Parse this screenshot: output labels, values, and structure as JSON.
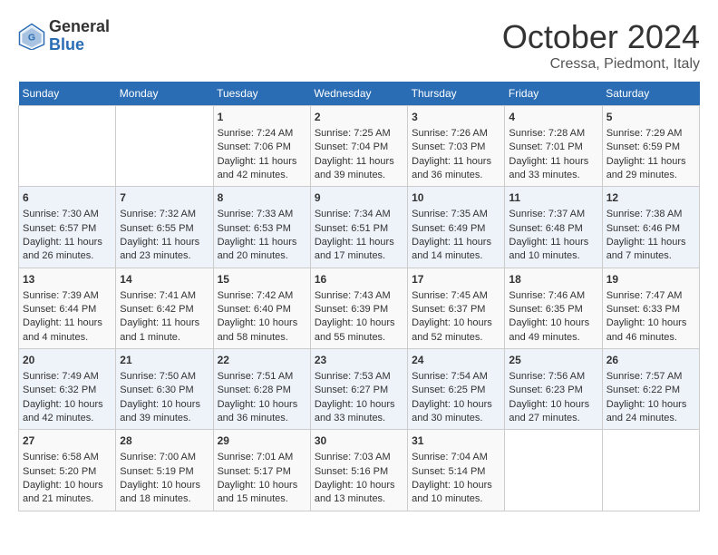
{
  "header": {
    "logo_general": "General",
    "logo_blue": "Blue",
    "title": "October 2024",
    "subtitle": "Cressa, Piedmont, Italy"
  },
  "days_of_week": [
    "Sunday",
    "Monday",
    "Tuesday",
    "Wednesday",
    "Thursday",
    "Friday",
    "Saturday"
  ],
  "weeks": [
    [
      {
        "day": "",
        "sunrise": "",
        "sunset": "",
        "daylight": ""
      },
      {
        "day": "",
        "sunrise": "",
        "sunset": "",
        "daylight": ""
      },
      {
        "day": "1",
        "sunrise": "Sunrise: 7:24 AM",
        "sunset": "Sunset: 7:06 PM",
        "daylight": "Daylight: 11 hours and 42 minutes."
      },
      {
        "day": "2",
        "sunrise": "Sunrise: 7:25 AM",
        "sunset": "Sunset: 7:04 PM",
        "daylight": "Daylight: 11 hours and 39 minutes."
      },
      {
        "day": "3",
        "sunrise": "Sunrise: 7:26 AM",
        "sunset": "Sunset: 7:03 PM",
        "daylight": "Daylight: 11 hours and 36 minutes."
      },
      {
        "day": "4",
        "sunrise": "Sunrise: 7:28 AM",
        "sunset": "Sunset: 7:01 PM",
        "daylight": "Daylight: 11 hours and 33 minutes."
      },
      {
        "day": "5",
        "sunrise": "Sunrise: 7:29 AM",
        "sunset": "Sunset: 6:59 PM",
        "daylight": "Daylight: 11 hours and 29 minutes."
      }
    ],
    [
      {
        "day": "6",
        "sunrise": "Sunrise: 7:30 AM",
        "sunset": "Sunset: 6:57 PM",
        "daylight": "Daylight: 11 hours and 26 minutes."
      },
      {
        "day": "7",
        "sunrise": "Sunrise: 7:32 AM",
        "sunset": "Sunset: 6:55 PM",
        "daylight": "Daylight: 11 hours and 23 minutes."
      },
      {
        "day": "8",
        "sunrise": "Sunrise: 7:33 AM",
        "sunset": "Sunset: 6:53 PM",
        "daylight": "Daylight: 11 hours and 20 minutes."
      },
      {
        "day": "9",
        "sunrise": "Sunrise: 7:34 AM",
        "sunset": "Sunset: 6:51 PM",
        "daylight": "Daylight: 11 hours and 17 minutes."
      },
      {
        "day": "10",
        "sunrise": "Sunrise: 7:35 AM",
        "sunset": "Sunset: 6:49 PM",
        "daylight": "Daylight: 11 hours and 14 minutes."
      },
      {
        "day": "11",
        "sunrise": "Sunrise: 7:37 AM",
        "sunset": "Sunset: 6:48 PM",
        "daylight": "Daylight: 11 hours and 10 minutes."
      },
      {
        "day": "12",
        "sunrise": "Sunrise: 7:38 AM",
        "sunset": "Sunset: 6:46 PM",
        "daylight": "Daylight: 11 hours and 7 minutes."
      }
    ],
    [
      {
        "day": "13",
        "sunrise": "Sunrise: 7:39 AM",
        "sunset": "Sunset: 6:44 PM",
        "daylight": "Daylight: 11 hours and 4 minutes."
      },
      {
        "day": "14",
        "sunrise": "Sunrise: 7:41 AM",
        "sunset": "Sunset: 6:42 PM",
        "daylight": "Daylight: 11 hours and 1 minute."
      },
      {
        "day": "15",
        "sunrise": "Sunrise: 7:42 AM",
        "sunset": "Sunset: 6:40 PM",
        "daylight": "Daylight: 10 hours and 58 minutes."
      },
      {
        "day": "16",
        "sunrise": "Sunrise: 7:43 AM",
        "sunset": "Sunset: 6:39 PM",
        "daylight": "Daylight: 10 hours and 55 minutes."
      },
      {
        "day": "17",
        "sunrise": "Sunrise: 7:45 AM",
        "sunset": "Sunset: 6:37 PM",
        "daylight": "Daylight: 10 hours and 52 minutes."
      },
      {
        "day": "18",
        "sunrise": "Sunrise: 7:46 AM",
        "sunset": "Sunset: 6:35 PM",
        "daylight": "Daylight: 10 hours and 49 minutes."
      },
      {
        "day": "19",
        "sunrise": "Sunrise: 7:47 AM",
        "sunset": "Sunset: 6:33 PM",
        "daylight": "Daylight: 10 hours and 46 minutes."
      }
    ],
    [
      {
        "day": "20",
        "sunrise": "Sunrise: 7:49 AM",
        "sunset": "Sunset: 6:32 PM",
        "daylight": "Daylight: 10 hours and 42 minutes."
      },
      {
        "day": "21",
        "sunrise": "Sunrise: 7:50 AM",
        "sunset": "Sunset: 6:30 PM",
        "daylight": "Daylight: 10 hours and 39 minutes."
      },
      {
        "day": "22",
        "sunrise": "Sunrise: 7:51 AM",
        "sunset": "Sunset: 6:28 PM",
        "daylight": "Daylight: 10 hours and 36 minutes."
      },
      {
        "day": "23",
        "sunrise": "Sunrise: 7:53 AM",
        "sunset": "Sunset: 6:27 PM",
        "daylight": "Daylight: 10 hours and 33 minutes."
      },
      {
        "day": "24",
        "sunrise": "Sunrise: 7:54 AM",
        "sunset": "Sunset: 6:25 PM",
        "daylight": "Daylight: 10 hours and 30 minutes."
      },
      {
        "day": "25",
        "sunrise": "Sunrise: 7:56 AM",
        "sunset": "Sunset: 6:23 PM",
        "daylight": "Daylight: 10 hours and 27 minutes."
      },
      {
        "day": "26",
        "sunrise": "Sunrise: 7:57 AM",
        "sunset": "Sunset: 6:22 PM",
        "daylight": "Daylight: 10 hours and 24 minutes."
      }
    ],
    [
      {
        "day": "27",
        "sunrise": "Sunrise: 6:58 AM",
        "sunset": "Sunset: 5:20 PM",
        "daylight": "Daylight: 10 hours and 21 minutes."
      },
      {
        "day": "28",
        "sunrise": "Sunrise: 7:00 AM",
        "sunset": "Sunset: 5:19 PM",
        "daylight": "Daylight: 10 hours and 18 minutes."
      },
      {
        "day": "29",
        "sunrise": "Sunrise: 7:01 AM",
        "sunset": "Sunset: 5:17 PM",
        "daylight": "Daylight: 10 hours and 15 minutes."
      },
      {
        "day": "30",
        "sunrise": "Sunrise: 7:03 AM",
        "sunset": "Sunset: 5:16 PM",
        "daylight": "Daylight: 10 hours and 13 minutes."
      },
      {
        "day": "31",
        "sunrise": "Sunrise: 7:04 AM",
        "sunset": "Sunset: 5:14 PM",
        "daylight": "Daylight: 10 hours and 10 minutes."
      },
      {
        "day": "",
        "sunrise": "",
        "sunset": "",
        "daylight": ""
      },
      {
        "day": "",
        "sunrise": "",
        "sunset": "",
        "daylight": ""
      }
    ]
  ]
}
